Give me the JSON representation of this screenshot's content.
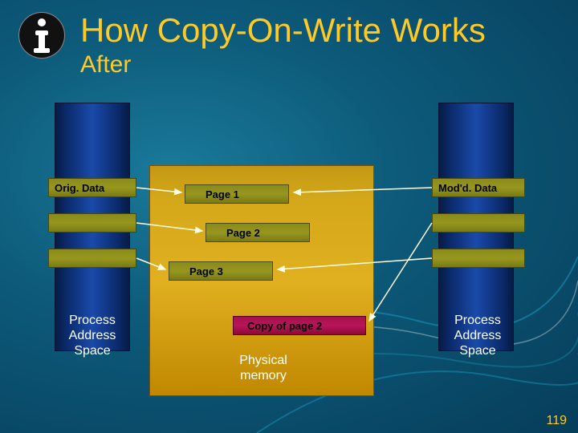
{
  "title": "How Copy-On-Write Works",
  "subtitle": "After",
  "left_band_label": "Orig. Data",
  "right_band_label": "Mod'd. Data",
  "pages": {
    "p1": "Page 1",
    "p2": "Page 2",
    "p3": "Page 3",
    "copy": "Copy of page 2"
  },
  "captions": {
    "left": "Process\nAddress\nSpace",
    "right": "Process\nAddress\nSpace",
    "center": "Physical\nmemory"
  },
  "page_number": "119",
  "colors": {
    "accent": "#ffc926"
  }
}
